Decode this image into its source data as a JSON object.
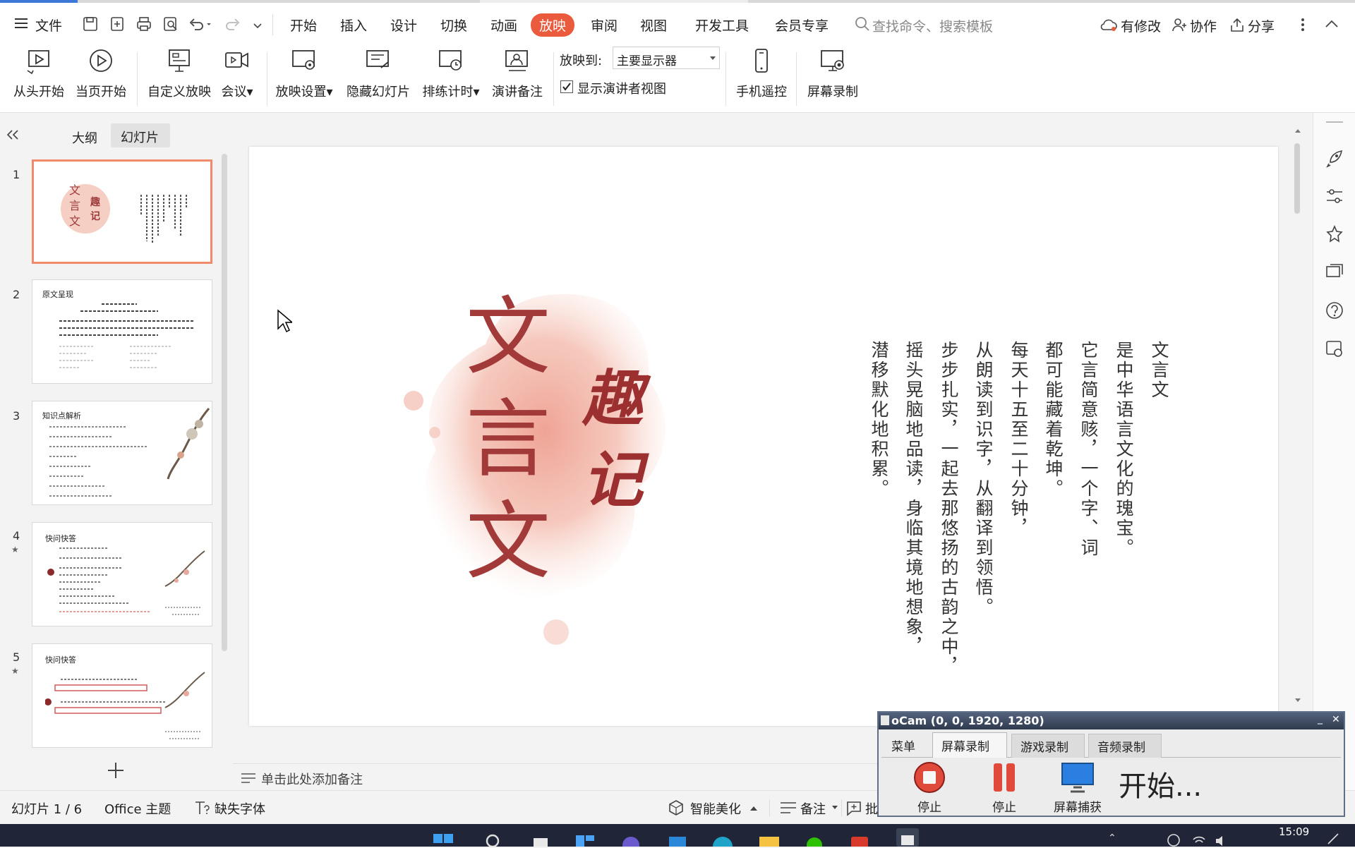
{
  "menubar": {
    "file_label": "文件",
    "tabs": [
      {
        "label": "开始"
      },
      {
        "label": "插入"
      },
      {
        "label": "设计"
      },
      {
        "label": "切换"
      },
      {
        "label": "动画"
      },
      {
        "label": "放映"
      },
      {
        "label": "审阅"
      },
      {
        "label": "视图"
      },
      {
        "label": "开发工具"
      },
      {
        "label": "会员专享"
      }
    ],
    "active_tab": "放映",
    "search_placeholder": "查找命令、搜索模板",
    "modified_label": "有修改",
    "collab_label": "协作",
    "share_label": "分享"
  },
  "ribbon": {
    "from_start": "从头开始",
    "from_current": "当页开始",
    "custom_show": "自定义放映",
    "meeting": "会议",
    "show_settings": "放映设置",
    "hide_slide": "隐藏幻灯片",
    "rehearse": "排练计时",
    "speaker_notes": "演讲备注",
    "show_to_label": "放映到:",
    "show_to_value": "主要显示器",
    "presenter_view_label": "显示演讲者视图",
    "presenter_view_checked": true,
    "phone_remote": "手机遥控",
    "screen_record": "屏幕录制"
  },
  "leftpanel": {
    "outline_tab": "大纲",
    "slides_tab": "幻灯片",
    "thumbnails": [
      {
        "num": "1"
      },
      {
        "num": "2",
        "title": "原文呈现"
      },
      {
        "num": "3",
        "title": "知识点解析"
      },
      {
        "num": "4",
        "title": "快问快答"
      },
      {
        "num": "5",
        "title": "快问快答"
      }
    ]
  },
  "slide": {
    "title_chars": [
      "文",
      "言",
      "文"
    ],
    "subtitle_chars": [
      "趣",
      "记"
    ],
    "text_columns": [
      "文言文",
      "是中华语言文化的瑰宝。",
      "它言简意赅，一个字、词",
      "都可能藏着乾坤。",
      "每天十五至二十分钟，",
      "从朗读到识字，从翻译到领悟。",
      "步步扎实，一起去那悠扬的古韵之中，",
      "摇头晃脑地品读，身临其境地想象，",
      "潜移默化地积累。"
    ]
  },
  "notes_placeholder": "单击此处添加备注",
  "statusbar": {
    "slide_counter": "幻灯片 1 / 6",
    "theme": "Office 主题",
    "missing_font": "缺失字体",
    "smart_beautify": "智能美化",
    "notes": "备注",
    "comment": "批"
  },
  "taskbar": {
    "time": "15:09"
  },
  "ocam": {
    "title": "oCam (0, 0, 1920, 1280)",
    "tabs": [
      "菜单",
      "屏幕录制",
      "游戏录制",
      "音频录制"
    ],
    "stop_label": "停止",
    "pause_label": "停止",
    "capture_label": "屏幕捕获",
    "status_text": "开始..."
  },
  "colors": {
    "accent": "#ea5a3c",
    "title_red": "#a33a3a",
    "ink_wash": "#f4bfb2"
  }
}
